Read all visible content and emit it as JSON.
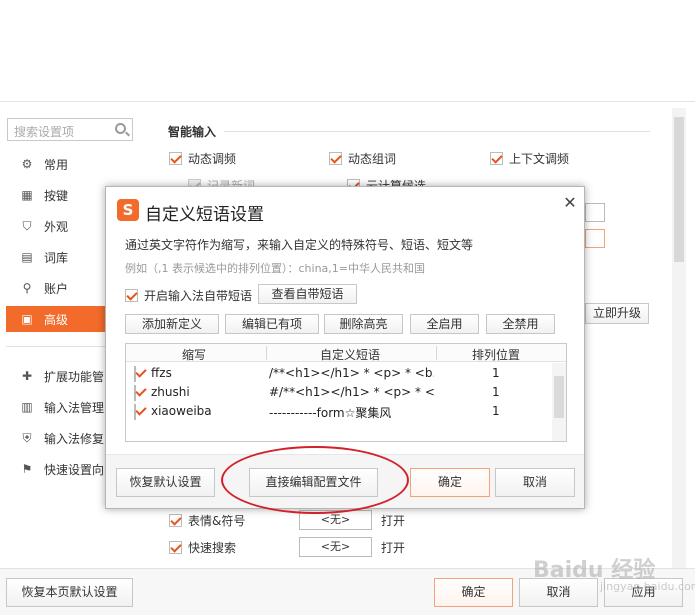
{
  "sidebar": {
    "search_placeholder": "搜索设置项",
    "items": [
      {
        "label": "常用",
        "icon": "settings-icon"
      },
      {
        "label": "按键",
        "icon": "keyboard-icon"
      },
      {
        "label": "外观",
        "icon": "shirt-icon"
      },
      {
        "label": "词库",
        "icon": "dictionary-icon"
      },
      {
        "label": "账户",
        "icon": "user-icon"
      },
      {
        "label": "高级",
        "icon": "advanced-icon",
        "active": true
      }
    ],
    "tools": [
      {
        "label": "扩展功能管",
        "icon": "extension-icon"
      },
      {
        "label": "输入法管理",
        "icon": "manage-icon"
      },
      {
        "label": "输入法修复",
        "icon": "repair-icon"
      },
      {
        "label": "快速设置向",
        "icon": "wizard-icon"
      }
    ],
    "restore_page_defaults": "恢复本页默认设置"
  },
  "main": {
    "section_title": "智能输入",
    "options": [
      {
        "label": "动态调频",
        "checked": true
      },
      {
        "label": "动态组词",
        "checked": true
      },
      {
        "label": "上下文调频",
        "checked": true
      },
      {
        "label": "记录新词",
        "checked": true,
        "disabled": true
      },
      {
        "label": "云计算候选",
        "checked": true
      }
    ],
    "upgrade_button": "立即升级",
    "hotkeys": [
      {
        "label": "表情&符号",
        "value": "<无>",
        "action": "打开",
        "checked": true
      },
      {
        "label": "快速搜索",
        "value": "<无>",
        "action": "打开",
        "checked": true
      }
    ],
    "ok": "确定",
    "cancel": "取消",
    "apply": "应用"
  },
  "dialog": {
    "title": "自定义短语设置",
    "description": "通过英文字符作为缩写，来输入自定义的特殊符号、短语、短文等",
    "example": "例如（,1 表示候选中的排列位置）：china,1=中华人民共和国",
    "enable_builtin": "开启输入法自带短语",
    "view_builtin": "查看自带短语",
    "actions": [
      "添加新定义",
      "编辑已有项",
      "删除高亮",
      "全启用",
      "全禁用"
    ],
    "columns": [
      "缩写",
      "自定义短语",
      "排列位置"
    ],
    "rows": [
      {
        "abbr": "ffzs",
        "phrase": "/**<h1></h1> * <p> * <b...",
        "pos": "1",
        "checked": true
      },
      {
        "abbr": "zhushi",
        "phrase": "#/**<h1></h1> * <p> * <...",
        "pos": "1",
        "checked": true
      },
      {
        "abbr": "xiaoweiba",
        "phrase": "-----------form☆聚集风",
        "pos": "1",
        "checked": true
      }
    ],
    "footer": {
      "restore_defaults": "恢复默认设置",
      "edit_config": "直接编辑配置文件",
      "ok": "确定",
      "cancel": "取消"
    }
  },
  "watermark": {
    "text": "Baidu 经验",
    "sub": "jingyan.baidu.com"
  },
  "colors": {
    "accent": "#f26b2a",
    "highlight_circle": "#d4202a"
  }
}
